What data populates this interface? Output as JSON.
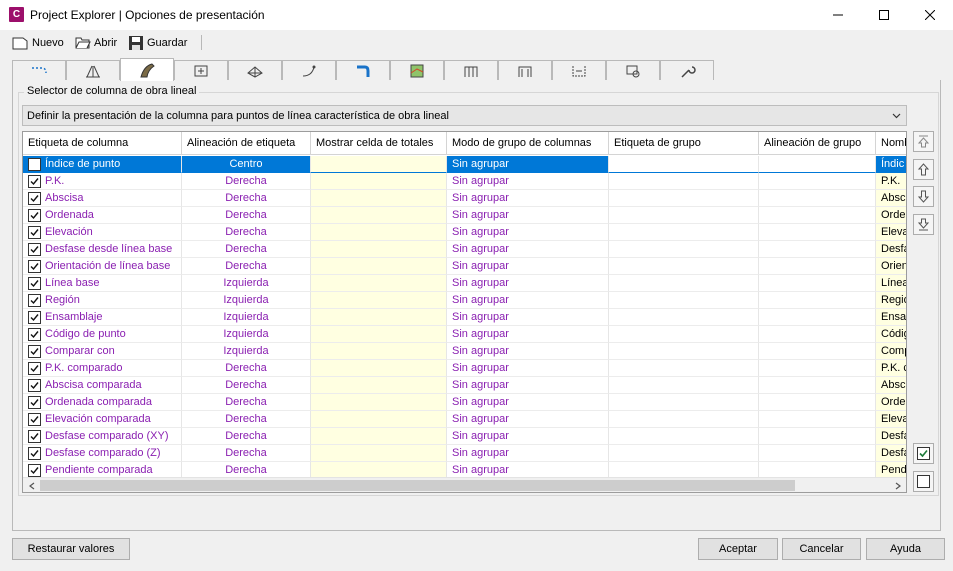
{
  "window": {
    "logo_text": "C",
    "title": "Project Explorer | Opciones de presentación"
  },
  "toolbar": {
    "new_label": "Nuevo",
    "open_label": "Abrir",
    "save_label": "Guardar"
  },
  "tabs": {
    "active_index": 2,
    "count": 13
  },
  "group": {
    "legend": "Selector de columna de obra lineal",
    "selected_value": "Definir la presentación de la columna para puntos de línea característica de obra lineal"
  },
  "grid": {
    "columns": [
      "Etiqueta de columna",
      "Alineación de etiqueta",
      "Mostrar celda de totales",
      "Modo de grupo de columnas",
      "Etiqueta de grupo",
      "Alineación de grupo",
      "Nomb"
    ],
    "rows": [
      {
        "checked": false,
        "label": "Índice de punto",
        "align": "Centro",
        "mode": "Sin agrupar",
        "name": "Índic",
        "selected": true
      },
      {
        "checked": true,
        "label": "P.K.",
        "align": "Derecha",
        "mode": "Sin agrupar",
        "name": "P.K."
      },
      {
        "checked": true,
        "label": "Abscisa",
        "align": "Derecha",
        "mode": "Sin agrupar",
        "name": "Absci"
      },
      {
        "checked": true,
        "label": "Ordenada",
        "align": "Derecha",
        "mode": "Sin agrupar",
        "name": "Orde"
      },
      {
        "checked": true,
        "label": "Elevación",
        "align": "Derecha",
        "mode": "Sin agrupar",
        "name": "Eleva"
      },
      {
        "checked": true,
        "label": "Desfase desde línea base",
        "align": "Derecha",
        "mode": "Sin agrupar",
        "name": "Desfa"
      },
      {
        "checked": true,
        "label": "Orientación de línea base",
        "align": "Derecha",
        "mode": "Sin agrupar",
        "name": "Orien"
      },
      {
        "checked": true,
        "label": "Línea base",
        "align": "Izquierda",
        "mode": "Sin agrupar",
        "name": "Línea"
      },
      {
        "checked": true,
        "label": "Región",
        "align": "Izquierda",
        "mode": "Sin agrupar",
        "name": "Regió"
      },
      {
        "checked": true,
        "label": "Ensamblaje",
        "align": "Izquierda",
        "mode": "Sin agrupar",
        "name": "Ensan"
      },
      {
        "checked": true,
        "label": "Código de punto",
        "align": "Izquierda",
        "mode": "Sin agrupar",
        "name": "Códig"
      },
      {
        "checked": true,
        "label": "Comparar con",
        "align": "Izquierda",
        "mode": "Sin agrupar",
        "name": "Comp"
      },
      {
        "checked": true,
        "label": "P.K. comparado",
        "align": "Derecha",
        "mode": "Sin agrupar",
        "name": "P.K. c"
      },
      {
        "checked": true,
        "label": "Abscisa comparada",
        "align": "Derecha",
        "mode": "Sin agrupar",
        "name": "Absci"
      },
      {
        "checked": true,
        "label": "Ordenada comparada",
        "align": "Derecha",
        "mode": "Sin agrupar",
        "name": "Orde"
      },
      {
        "checked": true,
        "label": "Elevación comparada",
        "align": "Derecha",
        "mode": "Sin agrupar",
        "name": "Eleva"
      },
      {
        "checked": true,
        "label": "Desfase comparado (XY)",
        "align": "Derecha",
        "mode": "Sin agrupar",
        "name": "Desfa"
      },
      {
        "checked": true,
        "label": "Desfase comparado (Z)",
        "align": "Derecha",
        "mode": "Sin agrupar",
        "name": "Desfa"
      },
      {
        "checked": true,
        "label": "Pendiente comparada",
        "align": "Derecha",
        "mode": "Sin agrupar",
        "name": "Pend"
      }
    ]
  },
  "buttons": {
    "restore": "Restaurar valores",
    "accept": "Aceptar",
    "cancel": "Cancelar",
    "help": "Ayuda"
  },
  "colors": {
    "accent": "#0078d7",
    "value_text": "#8a1fb1",
    "editable_cell": "#ffffe1"
  }
}
